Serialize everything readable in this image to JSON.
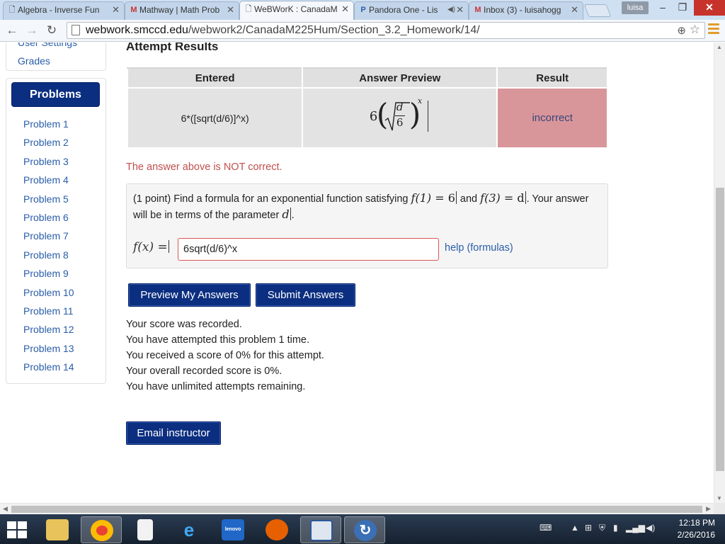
{
  "browser": {
    "tabs": [
      {
        "title": "Algebra - Inverse Fun",
        "icon": "page-icon",
        "active": false
      },
      {
        "title": "Mathway | Math Prob",
        "icon": "mathway-icon",
        "active": false
      },
      {
        "title": "WeBWorK : CanadaM",
        "icon": "page-icon",
        "active": true
      },
      {
        "title": "Pandora One - Lis",
        "icon": "pandora-icon",
        "active": false
      },
      {
        "title": "Inbox (3) - luisahogg",
        "icon": "gmail-icon",
        "active": false
      }
    ],
    "user_badge": "luisa",
    "url_host": "webwork.smccd.edu",
    "url_path": "/webwork2/CanadaM225Hum/Section_3.2_Homework/14/"
  },
  "sidebar": {
    "user_settings_label": "User Settings",
    "grades_label": "Grades",
    "problems_header": "Problems",
    "problems": [
      "Problem 1",
      "Problem 2",
      "Problem 3",
      "Problem 4",
      "Problem 5",
      "Problem 6",
      "Problem 7",
      "Problem 8",
      "Problem 9",
      "Problem 10",
      "Problem 11",
      "Problem 12",
      "Problem 13",
      "Problem 14"
    ]
  },
  "attempt": {
    "title": "Attempt Results",
    "headers": {
      "entered": "Entered",
      "preview": "Answer Preview",
      "result": "Result"
    },
    "entered": "6*([sqrt(d/6)]^x)",
    "preview": {
      "coef": "6",
      "num": "d",
      "den": "6",
      "exp": "x"
    },
    "result": "incorrect",
    "message": "The answer above is NOT correct."
  },
  "problem": {
    "text_1": "(1 point) Find a formula for an exponential function satisfying",
    "eq1_lhs": "f(1)",
    "eq1_rhs": "= 6",
    "conj": "and",
    "eq2_lhs": "f(3)",
    "eq2_rhs": "= d",
    "text_2": ". Your answer will be in terms of the parameter",
    "param": "d",
    "text_3": ".",
    "fx_label": "f(x) =",
    "answer_value": "6sqrt(d/6)^x",
    "help_label": "help (formulas)"
  },
  "buttons": {
    "preview": "Preview My Answers",
    "submit": "Submit Answers",
    "email": "Email instructor"
  },
  "score_lines": [
    "Your score was recorded.",
    "You have attempted this problem 1 time.",
    "You received a score of 0% for this attempt.",
    "Your overall recorded score is 0%.",
    "You have unlimited attempts remaining."
  ],
  "taskbar": {
    "items": [
      "file-explorer",
      "chrome",
      "document",
      "internet-explorer",
      "lenovo",
      "firefox",
      "publisher",
      "sync"
    ],
    "time": "12:18 PM",
    "date": "2/26/2016"
  },
  "colors": {
    "accent": "#0b2e80",
    "incorrect_bg": "#d9969a",
    "error_text": "#c0504d",
    "link": "#2a5ea8"
  }
}
